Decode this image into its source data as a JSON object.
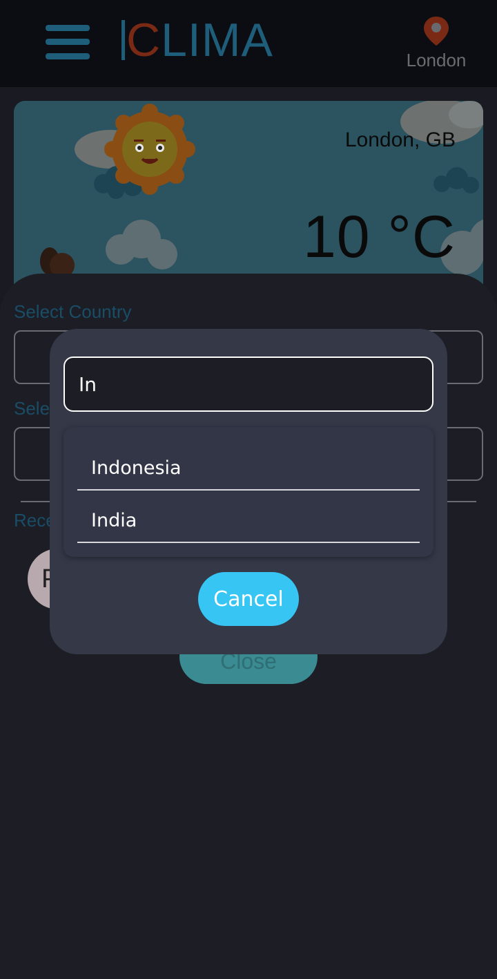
{
  "header": {
    "logo_letter": "C",
    "logo_rest": "LIMA",
    "location_label": "London"
  },
  "weather": {
    "city": "London, GB",
    "temperature": "10 °C"
  },
  "sheet": {
    "country_label": "Select Country",
    "city_label_partial": "Sele",
    "recent_label_partial": "Rece",
    "recent_avatar_letter": "P",
    "close_label": "Close"
  },
  "dialog": {
    "search_value": "In",
    "results": [
      "Indonesia",
      "India"
    ],
    "cancel_label": "Cancel"
  },
  "colors": {
    "accent": "#37c6f3",
    "dialog_bg": "#343847",
    "page_bg": "#1a1b22",
    "pin": "#7a2a14"
  },
  "icons": {
    "menu": "hamburger-icon",
    "location": "map-pin-icon"
  }
}
